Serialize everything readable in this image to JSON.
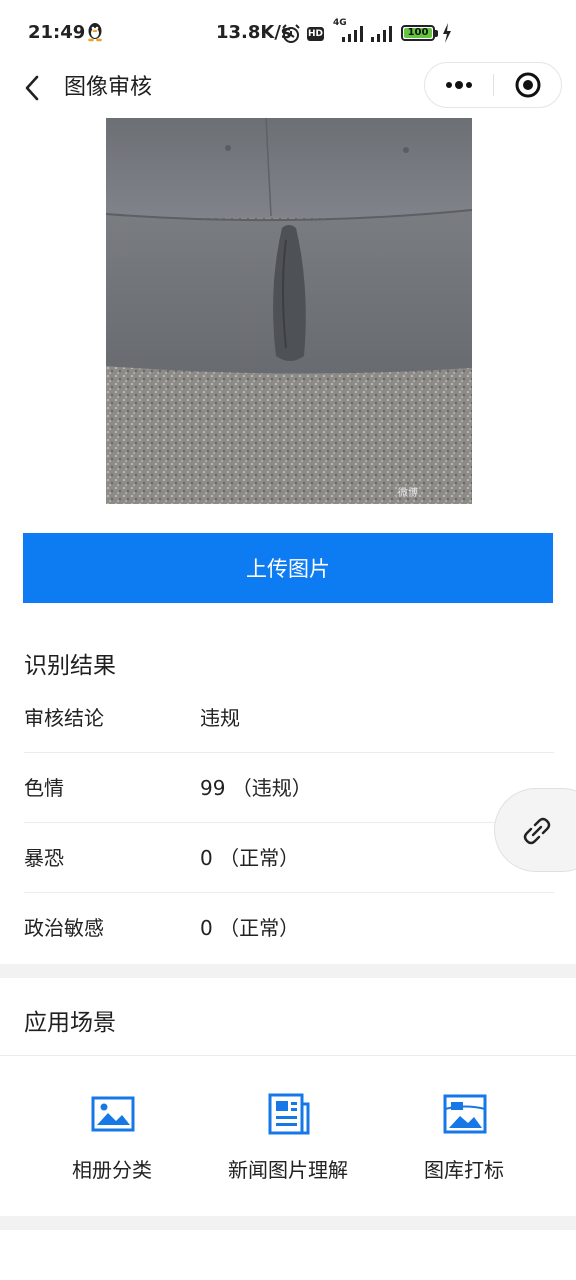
{
  "status_bar": {
    "time": "21:49",
    "network_speed": "13.8K/s",
    "hd_badge": "HD",
    "network_type": "4G",
    "battery": "100"
  },
  "nav": {
    "title": "图像审核",
    "back_icon": "chevron-left-icon",
    "more_icon": "more-dots-icon",
    "close_icon": "target-close-icon"
  },
  "preview": {
    "watermark": "微博"
  },
  "upload_button": "上传图片",
  "results": {
    "section_title": "识别结果",
    "rows": [
      {
        "label": "审核结论",
        "value": "违规"
      },
      {
        "label": "色情",
        "value": "99 （违规）"
      },
      {
        "label": "暴恐",
        "value": "0 （正常）"
      },
      {
        "label": "政治敏感",
        "value": "0 （正常）"
      }
    ]
  },
  "float_button_icon": "link-icon",
  "scenarios": {
    "section_title": "应用场景",
    "items": [
      {
        "label": "相册分类",
        "icon": "image-icon"
      },
      {
        "label": "新闻图片理解",
        "icon": "news-icon"
      },
      {
        "label": "图库打标",
        "icon": "gallery-icon"
      }
    ]
  },
  "colors": {
    "accent": "#0d7cf2",
    "background": "#ffffff",
    "band": "#f2f2f2"
  }
}
